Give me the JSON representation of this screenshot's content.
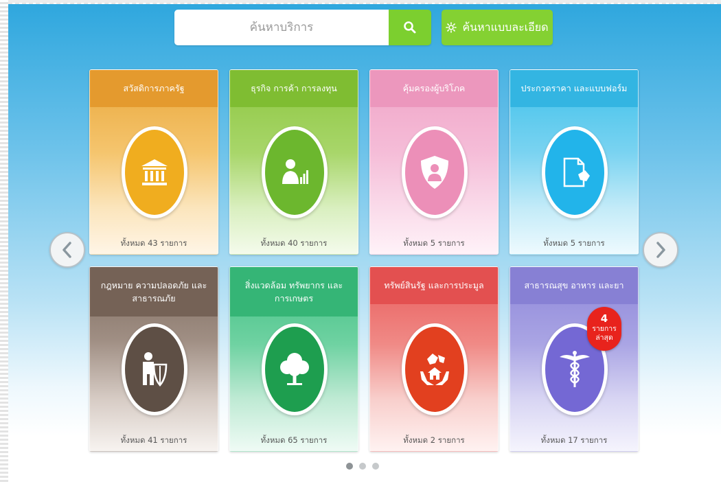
{
  "search": {
    "placeholder": "ค้นหาบริการ",
    "advanced_label": "ค้นหาแบบละเอียด",
    "search_icon": "search-icon",
    "advanced_icon": "gear-icon"
  },
  "carousel": {
    "prev_icon": "chevron-left-icon",
    "next_icon": "chevron-right-icon",
    "pages": 3,
    "active_page": 1
  },
  "cards": [
    {
      "title": "สวัสดิการภาครัฐ",
      "count": "ทั้งหมด 43 รายการ",
      "icon": "government-building-icon",
      "color": "#e9a73b"
    },
    {
      "title": "ธุรกิจ การค้า การลงทุน",
      "count": "ทั้งหมด 40 รายการ",
      "icon": "businessman-chart-icon",
      "color": "#8cc63f"
    },
    {
      "title": "คุ้มครองผู้บริโภค",
      "count": "ทั้งหมด 5 รายการ",
      "icon": "shield-person-icon",
      "color": "#f0a3c6"
    },
    {
      "title": "ประกวดราคา และแบบฟอร์ม",
      "count": "ทั้งหมด 5 รายการ",
      "icon": "document-icon",
      "color": "#3cc0ea"
    },
    {
      "title": "กฎหมาย ความปลอดภัย และสาธารณภัย",
      "count": "ทั้งหมด 41 รายการ",
      "icon": "person-shield-icon",
      "color": "#7d6a5e"
    },
    {
      "title": "สิ่งแวดล้อม ทรัพยากร และการเกษตร",
      "count": "ทั้งหมด 65 รายการ",
      "icon": "tree-icon",
      "color": "#3fbf82"
    },
    {
      "title": "ทรัพย์สินรัฐ และการประมูล",
      "count": "ทั้งหมด 2 รายการ",
      "icon": "hands-house-icon",
      "color": "#e85a5a"
    },
    {
      "title": "สาธารณสุข อาหาร และยา",
      "count": "ทั้งหมด 17 รายการ",
      "icon": "caduceus-icon",
      "color": "#8d86d9"
    }
  ],
  "badge": {
    "number": "4",
    "text": "รายการ ล่าสุด"
  }
}
